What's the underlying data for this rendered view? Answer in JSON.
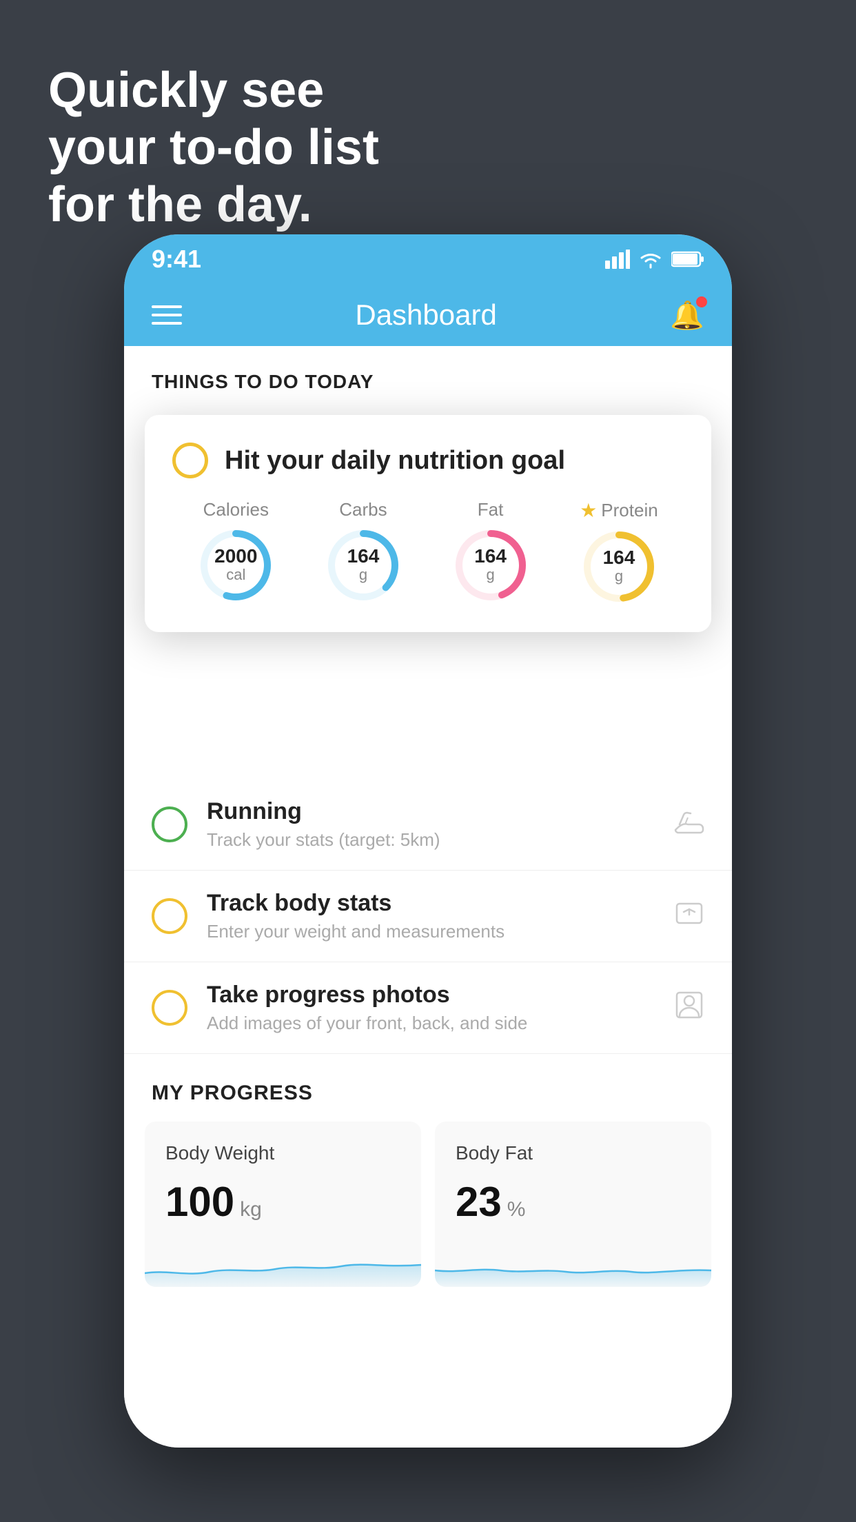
{
  "background": {
    "color": "#3a3f47"
  },
  "headline": {
    "line1": "Quickly see",
    "line2": "your to-do list",
    "line3": "for the day."
  },
  "phone": {
    "status_bar": {
      "time": "9:41",
      "signal_icon": "▌▌▌▌",
      "wifi_icon": "wifi",
      "battery_icon": "battery"
    },
    "nav": {
      "title": "Dashboard",
      "menu_icon": "hamburger",
      "bell_icon": "bell"
    },
    "things_today": {
      "header": "THINGS TO DO TODAY"
    },
    "floating_card": {
      "title": "Hit your daily nutrition goal",
      "nutrition": {
        "calories": {
          "label": "Calories",
          "value": "2000",
          "unit": "cal",
          "color": "#4db8e8"
        },
        "carbs": {
          "label": "Carbs",
          "value": "164",
          "unit": "g",
          "color": "#4db8e8"
        },
        "fat": {
          "label": "Fat",
          "value": "164",
          "unit": "g",
          "color": "#f06090"
        },
        "protein": {
          "label": "Protein",
          "value": "164",
          "unit": "g",
          "color": "#f0c030"
        }
      }
    },
    "todo_items": [
      {
        "title": "Running",
        "subtitle": "Track your stats (target: 5km)",
        "circle_color": "green",
        "icon": "shoe"
      },
      {
        "title": "Track body stats",
        "subtitle": "Enter your weight and measurements",
        "circle_color": "yellow",
        "icon": "scale"
      },
      {
        "title": "Take progress photos",
        "subtitle": "Add images of your front, back, and side",
        "circle_color": "yellow",
        "icon": "person"
      }
    ],
    "progress": {
      "header": "MY PROGRESS",
      "cards": [
        {
          "title": "Body Weight",
          "value": "100",
          "unit": "kg"
        },
        {
          "title": "Body Fat",
          "value": "23",
          "unit": "%"
        }
      ]
    }
  }
}
